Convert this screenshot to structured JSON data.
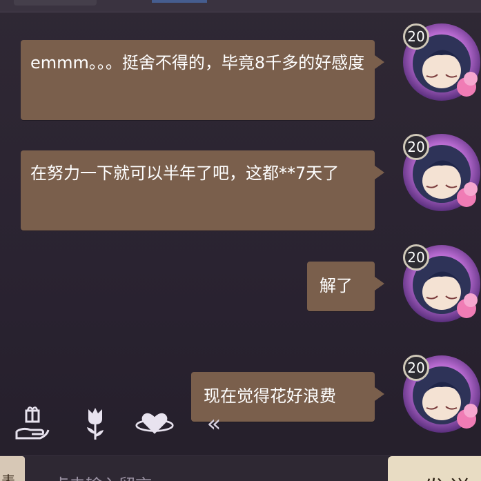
{
  "messages": [
    {
      "text": "emmm。。。挺舍不得的，毕竟8千多的好感度",
      "level": "20"
    },
    {
      "text": "在努力一下就可以半年了吧，这都**7天了",
      "level": "20"
    },
    {
      "text": "解了",
      "level": "20"
    },
    {
      "text": "现在觉得花好浪费",
      "level": "20"
    }
  ],
  "toolbar": {
    "gift_icon": "gift-hand-icon",
    "flower_icon": "tulip-icon",
    "heart_icon": "heart-orbit-icon",
    "collapse_label": "«"
  },
  "input": {
    "left_button_label": "表",
    "placeholder_visible": "点击输入留言",
    "send_label": "发送"
  },
  "colors": {
    "bubble": "#7a5f4c",
    "background": "#2b2430",
    "send_button": "#e8dcc3"
  }
}
